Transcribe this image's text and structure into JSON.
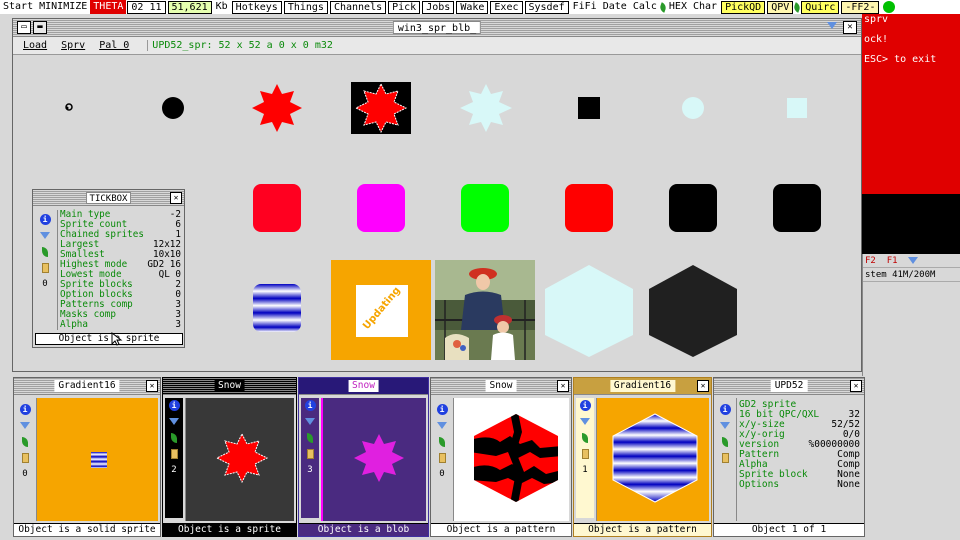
{
  "topbar": {
    "items": [
      {
        "label": "Start",
        "style": "plain"
      },
      {
        "label": "MINIMIZE",
        "style": "plain"
      },
      {
        "label": "THETA",
        "style": "red"
      },
      {
        "label": "02 11",
        "style": "box"
      },
      {
        "label": "51,621",
        "style": "lgreen"
      },
      {
        "label": "Kb",
        "style": "plain"
      },
      {
        "label": "Hotkeys",
        "style": "box"
      },
      {
        "label": "Things",
        "style": "box"
      },
      {
        "label": "Channels",
        "style": "box"
      },
      {
        "label": "Pick",
        "style": "box"
      },
      {
        "label": "Jobs",
        "style": "box"
      },
      {
        "label": "Wake",
        "style": "box"
      },
      {
        "label": "Exec",
        "style": "box"
      },
      {
        "label": "Sysdef",
        "style": "box"
      },
      {
        "label": "FiFi",
        "style": "plain"
      },
      {
        "label": "Date",
        "style": "plain"
      },
      {
        "label": "Calc",
        "style": "plain"
      },
      {
        "label": "HEX",
        "style": "plain"
      },
      {
        "label": "Char",
        "style": "plain"
      },
      {
        "label": "PickQD",
        "style": "yellow"
      },
      {
        "label": "QPV",
        "style": "cream"
      },
      {
        "label": "Quirc",
        "style": "yellow"
      },
      {
        "label": "-FF2-",
        "style": "cream"
      }
    ]
  },
  "background_window": {
    "lines": [
      "sprv",
      "ock!",
      "ESC> to exit"
    ],
    "row1": {
      "a": "F2",
      "b": "F1"
    },
    "row2": "stem 41M/200M"
  },
  "main_window": {
    "title": "win3_spr_blb_",
    "menu": [
      "Load",
      "Sprv",
      "Pal 0"
    ],
    "sprite_info": "UPD52_spr: 52 x 52 a 0 x 0  m32",
    "updating_text": "Updating"
  },
  "tickbox": {
    "title": "TICKBOX",
    "rows": [
      {
        "label": "Main type",
        "value": "-2"
      },
      {
        "label": "Sprite count",
        "value": "6"
      },
      {
        "label": "Chained sprites",
        "value": "1"
      },
      {
        "label": "Largest",
        "value": "12x12"
      },
      {
        "label": "Smallest",
        "value": "10x10"
      },
      {
        "label": "Highest mode",
        "value": "GD2 16"
      },
      {
        "label": "Lowest mode",
        "value": "QL 0"
      },
      {
        "label": "Sprite blocks",
        "value": "2"
      },
      {
        "label": "Option blocks",
        "value": "0"
      },
      {
        "label": "Patterns comp",
        "value": "3"
      },
      {
        "label": "Masks comp",
        "value": "3"
      },
      {
        "label": "Alpha",
        "value": "3"
      }
    ],
    "counter": "0",
    "status": "Object is a sprite"
  },
  "panes": [
    {
      "title": "Gradient16",
      "counter": "0",
      "status": "Object is a solid sprite"
    },
    {
      "title": "Snow",
      "counter": "2",
      "status": "Object is a sprite"
    },
    {
      "title": "Snow",
      "counter": "3",
      "status": "Object is a blob"
    },
    {
      "title": "Snow",
      "counter": "0",
      "status": "Object is a pattern"
    },
    {
      "title": "Gradient16",
      "counter": "1",
      "status": "Object is a pattern"
    },
    {
      "title": "UPD52",
      "counter": "",
      "status": "Object 1 of 1"
    }
  ],
  "upd52": {
    "rows": [
      {
        "label": "GD2 sprite",
        "value": ""
      },
      {
        "label": "16 bit QPC/QXL",
        "value": "32"
      },
      {
        "label": "x/y-size",
        "value": "52/52"
      },
      {
        "label": "x/y-orig",
        "value": "0/0"
      },
      {
        "label": "version",
        "value": "%00000000"
      },
      {
        "label": "Pattern",
        "value": "Comp"
      },
      {
        "label": "Alpha",
        "value": "Comp"
      },
      {
        "label": "Sprite block",
        "value": "None"
      },
      {
        "label": "Options",
        "value": "None"
      }
    ]
  },
  "colors": {
    "red": "#ff0000",
    "magenta": "#ff00ff",
    "green": "#00ff00",
    "black": "#000000",
    "orange": "#f6a500",
    "lightcyan": "#d8f8f8",
    "darkhex": "#202020",
    "bgred": "#e00000"
  }
}
